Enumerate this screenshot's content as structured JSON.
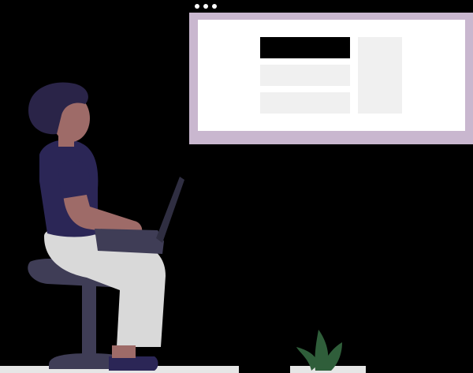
{
  "illustration": {
    "subject": "person-working-on-laptop",
    "colors": {
      "background": "#000000",
      "browser_frame": "#c9b7cf",
      "browser_canvas": "#ffffff",
      "content_header_block": "#000000",
      "content_placeholder_block": "#f0f0f0",
      "window_dots": "#ffffff",
      "skin": "#9e6b68",
      "hair": "#2a2448",
      "shirt": "#2b2656",
      "pants": "#d9d9d9",
      "shoe": "#2b2656",
      "stool": "#3f3d56",
      "laptop": "#3f3d56",
      "laptop_screen": "#2f2e41",
      "floor": "#e6e6e6",
      "plant": "#2f5e3a"
    },
    "icons": [
      "window-dots-icon",
      "plant-icon",
      "laptop-icon",
      "stool-icon"
    ]
  }
}
